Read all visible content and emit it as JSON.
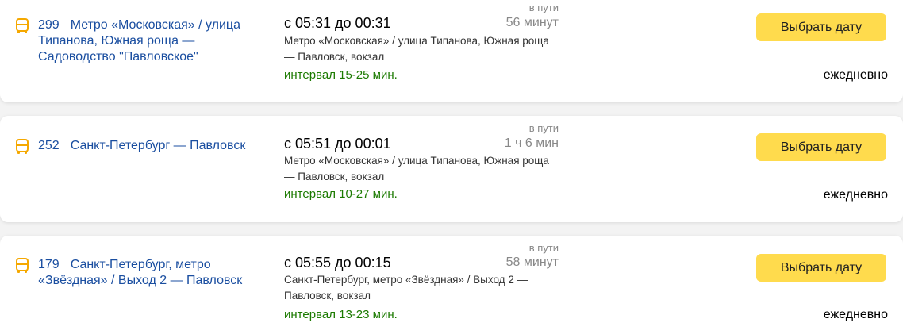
{
  "colors": {
    "link": "#1a4ea0",
    "interval": "#1b7a00",
    "muted": "#888888",
    "button": "#ffdb4d",
    "icon": "#f5a800"
  },
  "routes": [
    {
      "icon": "bus-icon",
      "number": "299",
      "name": "Метро «Московская» / улица Типанова, Южная роща — Садоводство \"Павловское\"",
      "times": "с 05:31 до 00:31",
      "duration_label": "в пути",
      "duration": "56 минут",
      "stop": "Метро «Московская» / улица Типанова, Южная роща — Павловск, вокзал",
      "interval": "интервал 15-25 мин.",
      "button_label": "Выбрать дату",
      "schedule": "ежедневно"
    },
    {
      "icon": "bus-icon",
      "number": "252",
      "name": "Санкт-Петербург — Павловск",
      "times": "с 05:51 до 00:01",
      "duration_label": "в пути",
      "duration": "1 ч 6 мин",
      "stop": "Метро «Московская» / улица Типанова, Южная роща — Павловск, вокзал",
      "interval": "интервал 10-27 мин.",
      "button_label": "Выбрать дату",
      "schedule": "ежедневно"
    },
    {
      "icon": "bus-icon",
      "number": "179",
      "name": "Санкт-Петербург, метро «Звёздная» / Выход 2 — Павловск",
      "times": "с 05:55 до 00:15",
      "duration_label": "в пути",
      "duration": "58 минут",
      "stop": "Санкт-Петербург, метро «Звёздная» / Выход 2 — Павловск, вокзал",
      "interval": "интервал 13-23 мин.",
      "button_label": "Выбрать дату",
      "schedule": "ежедневно"
    }
  ]
}
